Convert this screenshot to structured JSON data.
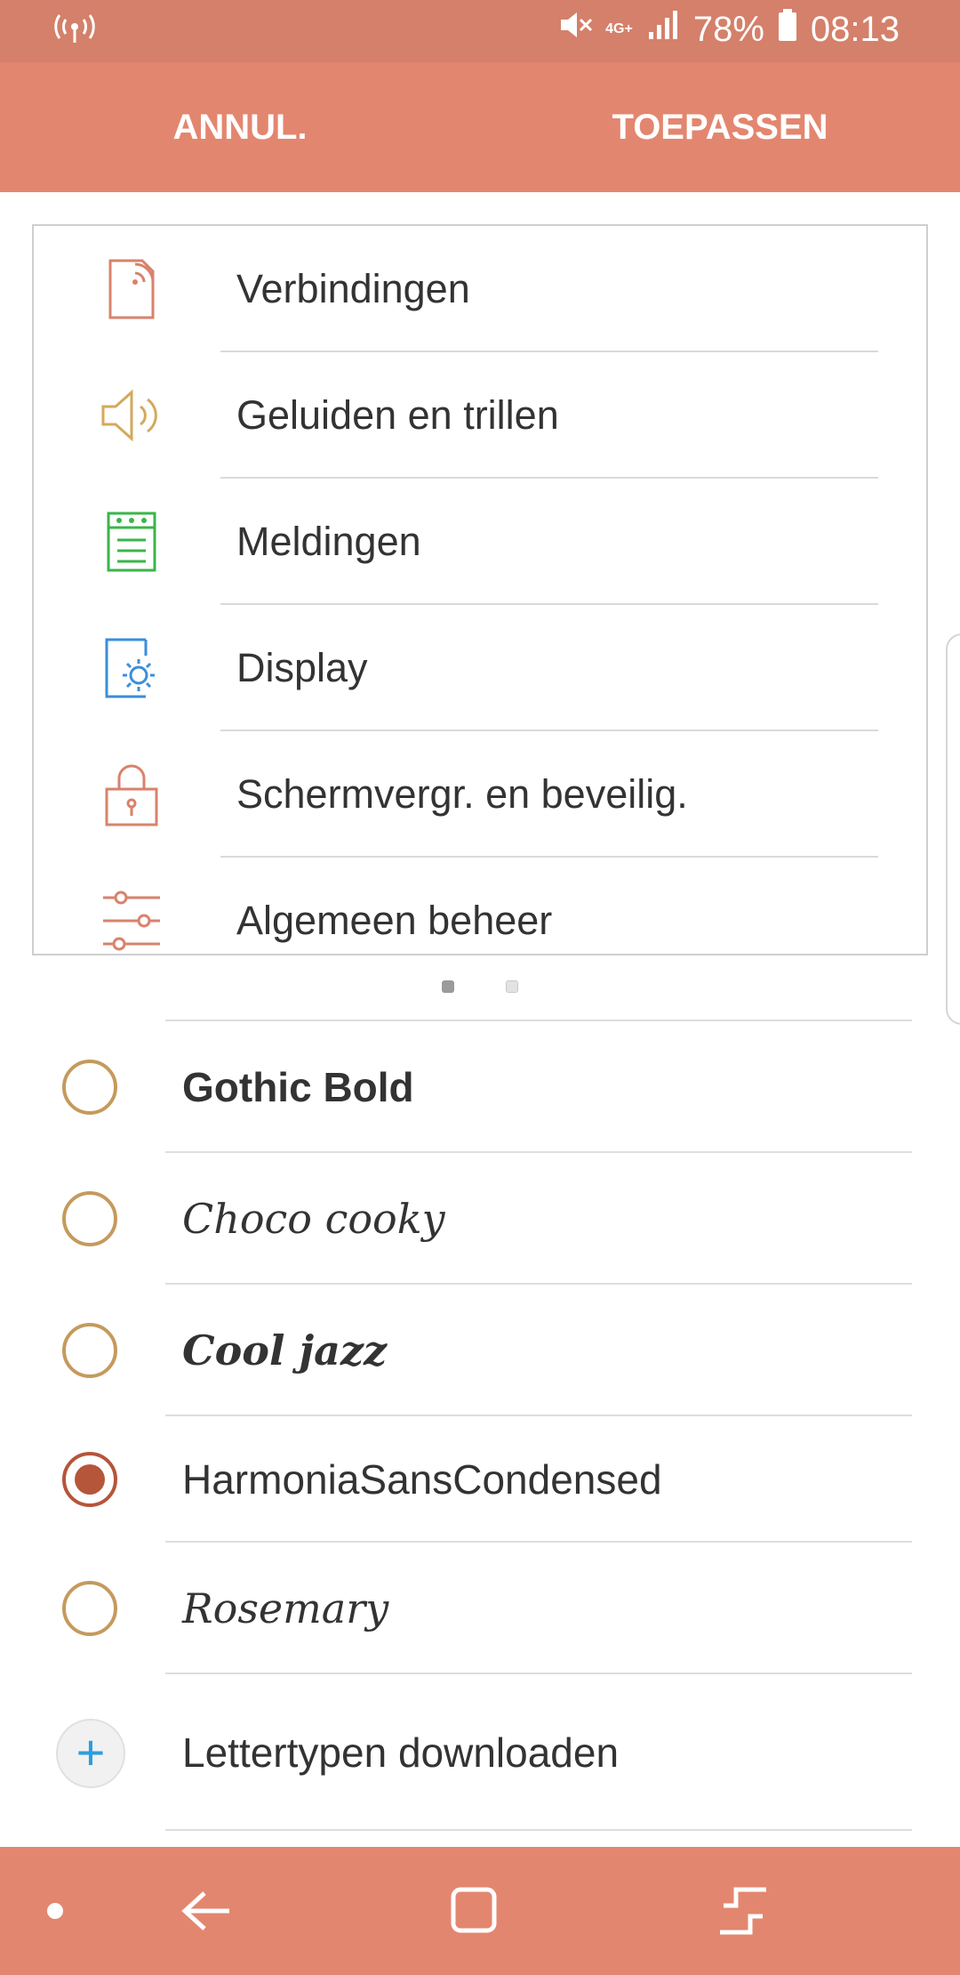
{
  "status_bar": {
    "left_icon": "hotspot-icon",
    "mute_icon": "mute-icon",
    "network": "4G+",
    "signal_icon": "signal-icon",
    "battery_level": "78%",
    "battery_icon": "battery-icon",
    "time": "08:13"
  },
  "action_bar": {
    "cancel_label": "ANNUL.",
    "apply_label": "TOEPASSEN"
  },
  "preview": {
    "items": [
      {
        "label": "Verbindingen",
        "icon": "connections-icon",
        "color": "#d9826b"
      },
      {
        "label": "Geluiden en trillen",
        "icon": "speaker-icon",
        "color": "#d4a95a"
      },
      {
        "label": "Meldingen",
        "icon": "notifications-icon",
        "color": "#3ab54a"
      },
      {
        "label": "Display",
        "icon": "display-icon",
        "color": "#3a8edb"
      },
      {
        "label": "Schermvergr. en beveilig.",
        "icon": "lock-icon",
        "color": "#d9826b"
      },
      {
        "label": "Algemeen beheer",
        "icon": "sliders-icon",
        "color": "#d9826b"
      }
    ],
    "page_count": 2,
    "active_page": 1
  },
  "fonts": {
    "selected_index": 3,
    "items": [
      {
        "label": "Gothic Bold",
        "selected": false
      },
      {
        "label": "Choco cooky",
        "selected": false
      },
      {
        "label": "Cool jazz",
        "selected": false
      },
      {
        "label": "HarmoniaSansCondensed",
        "selected": true
      },
      {
        "label": "Rosemary",
        "selected": false
      }
    ],
    "download_label": "Lettertypen downloaden",
    "download_icon": "plus-icon"
  },
  "colors": {
    "accent": "#e3866f",
    "status_bar": "#d4806a",
    "radio_unselected": "#c59a5c",
    "radio_selected": "#b5553a",
    "plus": "#2a9ee0"
  },
  "nav_bar": {
    "items": [
      "dot-icon",
      "back-icon",
      "home-icon",
      "recents-icon"
    ]
  }
}
